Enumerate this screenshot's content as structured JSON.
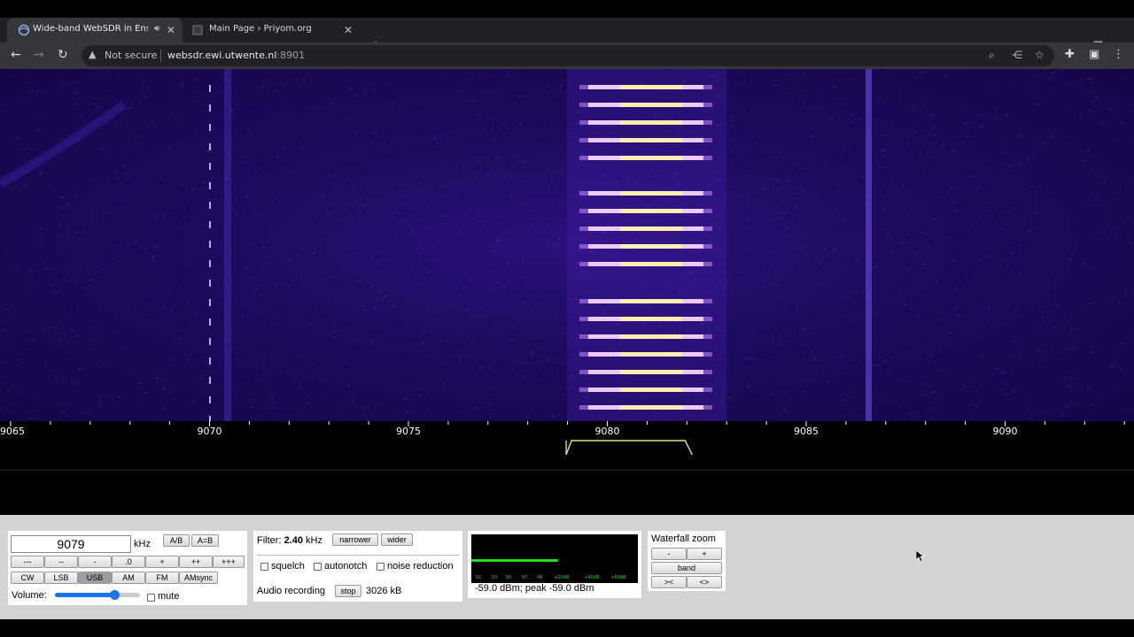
{
  "browser": {
    "tabs": [
      {
        "title": "Wide-band WebSDR in Ensch",
        "active": true,
        "audio": true
      },
      {
        "title": "Main Page › Priyom.org",
        "active": false
      }
    ],
    "new_tab": "+",
    "address": {
      "warning_label": "Not secure",
      "host": "websdr.ewi.utwente.nl",
      "port": ":8901"
    }
  },
  "scale": {
    "ticks": [
      "9065",
      "9070",
      "9075",
      "9080",
      "9085",
      "9090"
    ],
    "passband": {
      "low_khz": 9079.1,
      "high_khz": 9082.0
    }
  },
  "frequency": {
    "value": "9079",
    "unit": "kHz",
    "ab_label": "A/B",
    "a_eq_b_label": "A=B"
  },
  "step_buttons": [
    "---",
    "--",
    "-",
    ".0",
    "+",
    "++",
    "+++"
  ],
  "modes": [
    {
      "label": "CW",
      "selected": false
    },
    {
      "label": "LSB",
      "selected": false
    },
    {
      "label": "USB",
      "selected": true
    },
    {
      "label": "AM",
      "selected": false
    },
    {
      "label": "FM",
      "selected": false
    },
    {
      "label": "AMsync",
      "selected": false
    }
  ],
  "volume": {
    "label": "Volume:",
    "level": 0.7,
    "mute_label": "mute",
    "muted": false
  },
  "filter": {
    "label": "Filter:",
    "value": "2.40",
    "unit": "kHz",
    "narrower_label": "narrower",
    "wider_label": "wider",
    "options": [
      {
        "label": "squelch",
        "checked": false
      },
      {
        "label": "autonotch",
        "checked": false
      },
      {
        "label": "noise reduction",
        "checked": false
      }
    ],
    "recording_label": "Audio recording",
    "stop_label": "stop",
    "recording_size": "3026 kB"
  },
  "smeter": {
    "scale_labels": [
      "S1",
      "S3",
      "S5",
      "S7",
      "S9",
      "+20dB",
      "+40dB",
      "+60dB"
    ],
    "level": 0.52,
    "readout": "-59.0 dBm; peak  -59.0 dBm",
    "bar_color": "#22dd22"
  },
  "zoom": {
    "title": "Waterfall zoom",
    "minus_label": "-",
    "plus_label": "+",
    "band_label": "band",
    "in_label": "><",
    "out_label": "<>"
  },
  "colors": {
    "waterfall_bg": "#1d0b5e",
    "signal": "#fff2a8",
    "passband": "#e6e27a"
  }
}
